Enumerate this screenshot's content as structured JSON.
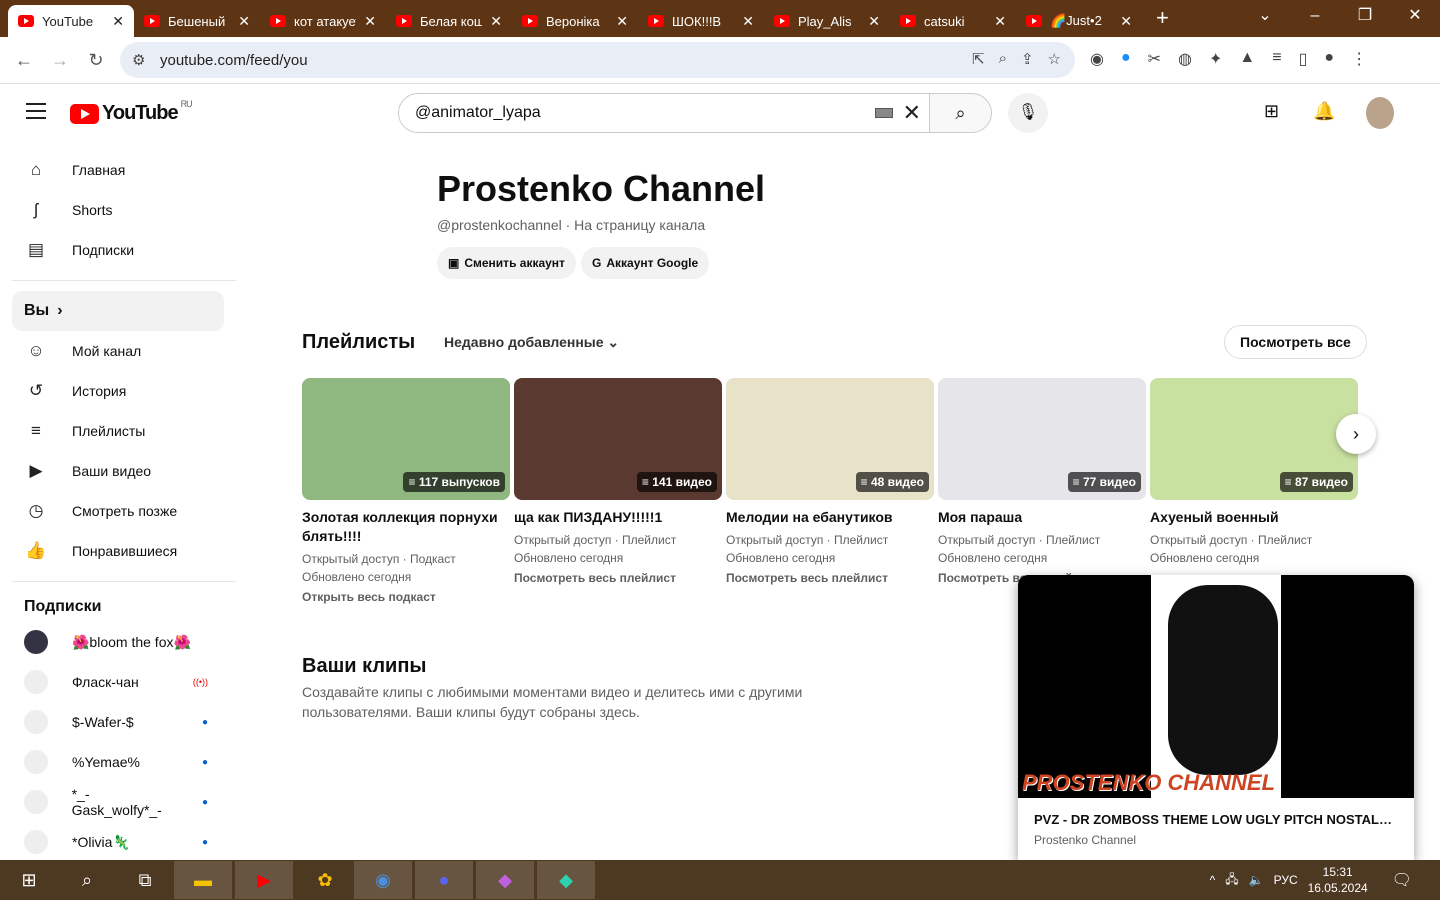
{
  "browser": {
    "tabs": [
      {
        "title": "YouTube",
        "active": true
      },
      {
        "title": "Бешеный"
      },
      {
        "title": "кот атакует"
      },
      {
        "title": "Белая кошка"
      },
      {
        "title": "Вероніка"
      },
      {
        "title": "ШОК!!!В"
      },
      {
        "title": "Play_Alis"
      },
      {
        "title": "catsuki"
      },
      {
        "title": "🌈Just•2"
      }
    ],
    "url": "youtube.com/feed/you"
  },
  "header": {
    "logo": "YouTube",
    "region": "RU",
    "search_value": "@animator_lyapa"
  },
  "sidebar": {
    "main": [
      {
        "icon": "home-icon",
        "label": "Главная"
      },
      {
        "icon": "shorts-icon",
        "label": "Shorts"
      },
      {
        "icon": "subscriptions-icon",
        "label": "Подписки"
      }
    ],
    "you_label": "Вы",
    "you": [
      {
        "icon": "channel-icon",
        "label": "Мой канал"
      },
      {
        "icon": "history-icon",
        "label": "История"
      },
      {
        "icon": "playlists-icon",
        "label": "Плейлисты"
      },
      {
        "icon": "your-videos-icon",
        "label": "Ваши видео"
      },
      {
        "icon": "watch-later-icon",
        "label": "Смотреть позже"
      },
      {
        "icon": "liked-icon",
        "label": "Понравившиеся"
      }
    ],
    "subs_title": "Подписки",
    "subs": [
      {
        "name": "🌺bloom the fox🌺",
        "status": ""
      },
      {
        "name": "Фласк-чан",
        "status": "live"
      },
      {
        "name": "$-Wafer-$",
        "status": "new"
      },
      {
        "name": "%Yemae%",
        "status": "new"
      },
      {
        "name": "*_-Gask_wolfy*_-",
        "status": "new"
      },
      {
        "name": "*Olivia🦎",
        "status": "new"
      }
    ]
  },
  "channel": {
    "name": "Prostenko Channel",
    "handle": "@prostenkochannel · На страницу канала",
    "switch_account": "Сменить аккаунт",
    "google_account": "Аккаунт Google"
  },
  "playlists": {
    "title": "Плейлисты",
    "sort": "Недавно добавленные",
    "see_all": "Посмотреть все",
    "items": [
      {
        "title": "Золотая коллекция порнухи блять!!!!",
        "badge": "117 выпусков",
        "meta1": "Открытый доступ · Подкаст",
        "meta2": "Обновлено сегодня",
        "link": "Открыть весь подкаст",
        "color": "#8fb880"
      },
      {
        "title": "ща как ПИЗДАНУ!!!!!1",
        "badge": "141 видео",
        "meta1": "Открытый доступ · Плейлист",
        "meta2": "Обновлено сегодня",
        "link": "Посмотреть весь плейлист",
        "color": "#5a3a30"
      },
      {
        "title": "Мелодии на ебанутиков",
        "badge": "48 видео",
        "meta1": "Открытый доступ · Плейлист",
        "meta2": "Обновлено сегодня",
        "link": "Посмотреть весь плейлист",
        "color": "#e8e2c8"
      },
      {
        "title": "Моя параша",
        "badge": "77 видео",
        "meta1": "Открытый доступ · Плейлист",
        "meta2": "Обновлено сегодня",
        "link": "Посмотреть весь плейлист",
        "color": "#e6e6ea"
      },
      {
        "title": "Ахуеный военный",
        "badge": "87 видео",
        "meta1": "Открытый доступ · Плейлист",
        "meta2": "Обновлено сегодня",
        "link": "",
        "color": "#c8e0a0"
      }
    ]
  },
  "clips": {
    "title": "Ваши клипы",
    "desc": "Создавайте клипы с любимыми моментами видео и делитесь ими с другими пользователями. Ваши клипы будут собраны здесь."
  },
  "miniplayer": {
    "title": "PVZ - DR ZOMBOSS THEME LOW UGLY PITCH NOSTALGI...",
    "channel": "Prostenko Channel",
    "watermark": "PROSTENKO CHANNEL"
  },
  "taskbar": {
    "lang": "РУС",
    "time": "15:31",
    "date": "16.05.2024"
  }
}
